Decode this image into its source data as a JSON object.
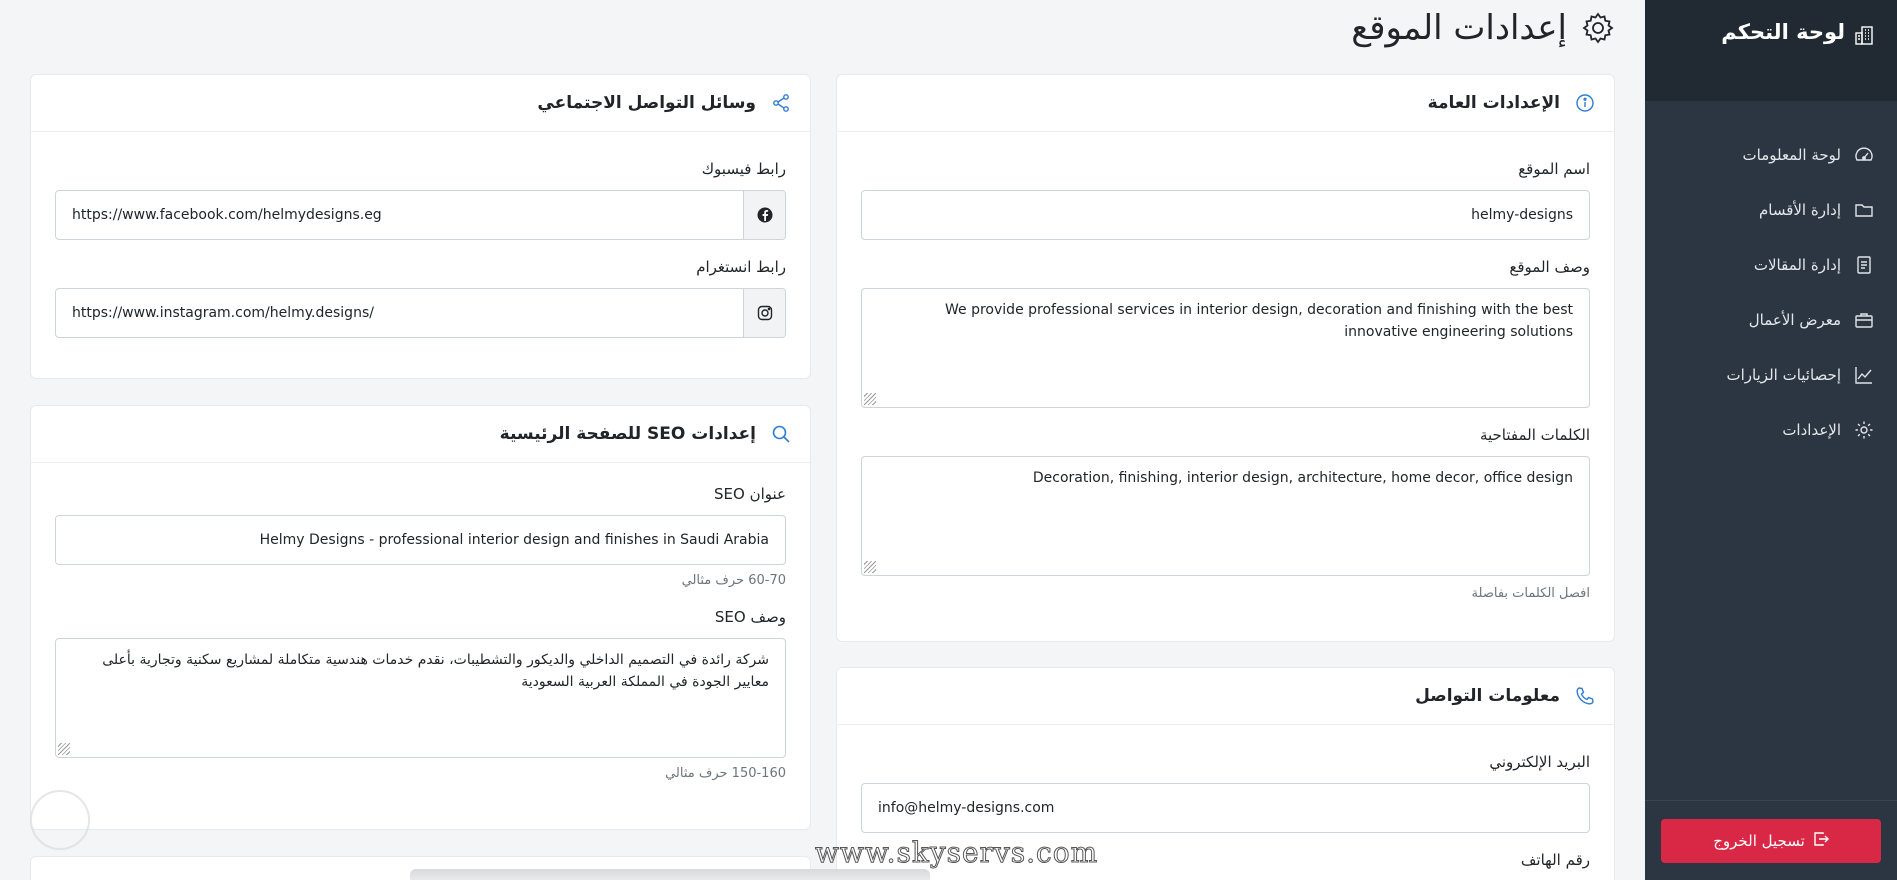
{
  "sidebar": {
    "brand": "لوحة التحكم",
    "items": [
      {
        "label": "لوحة المعلومات",
        "icon": "speedometer-icon"
      },
      {
        "label": "إدارة الأقسام",
        "icon": "folder-icon"
      },
      {
        "label": "إدارة المقالات",
        "icon": "document-icon"
      },
      {
        "label": "معرض الأعمال",
        "icon": "briefcase-icon"
      },
      {
        "label": "إحصائيات الزيارات",
        "icon": "graph-up-icon"
      },
      {
        "label": "الإعدادات",
        "icon": "gear-icon"
      }
    ],
    "logout_label": "تسجيل الخروج"
  },
  "header": {
    "title": "إعدادات الموقع"
  },
  "general": {
    "title": "الإعدادات العامة",
    "site_name_label": "اسم الموقع",
    "site_name_value": "helmy-designs",
    "site_desc_label": "وصف الموقع",
    "site_desc_value": "We provide professional services in interior design, decoration and finishing with the best innovative engineering solutions",
    "keywords_label": "الكلمات المفتاحية",
    "keywords_value": "Decoration, finishing, interior design, architecture, home decor, office design",
    "keywords_hint": "افصل الكلمات بفاصلة"
  },
  "contact": {
    "title": "معلومات التواصل",
    "email_label": "البريد الإلكتروني",
    "email_value": "info@helmy-designs.com",
    "phone_label": "رقم الهاتف"
  },
  "social": {
    "title": "وسائل التواصل الاجتماعي",
    "facebook_label": "رابط فيسبوك",
    "facebook_value": "https://www.facebook.com/helmydesigns.eg",
    "instagram_label": "رابط انستغرام",
    "instagram_value": "https://www.instagram.com/helmy.designs/"
  },
  "seo": {
    "title": "إعدادات SEO للصفحة الرئيسية",
    "seo_title_label": "عنوان SEO",
    "seo_title_value": "Helmy Designs - professional interior design and finishes in Saudi Arabia",
    "seo_title_hint": "60-70 حرف مثالي",
    "seo_desc_label": "وصف SEO",
    "seo_desc_value": "شركة رائدة في التصميم الداخلي والديكور والتشطيبات، نقدم خدمات هندسية متكاملة لمشاريع سكنية وتجارية بأعلى معايير الجودة في المملكة العربية السعودية",
    "seo_desc_hint": "150-160 حرف مثالي"
  },
  "watermark": "www.skyservs.com",
  "colors": {
    "sidebar_bg": "#2c3642",
    "sidebar_brand_bg": "#212a33",
    "accent": "#2f7dd3",
    "logout": "#d92845",
    "page_bg": "#f4f5f7"
  }
}
